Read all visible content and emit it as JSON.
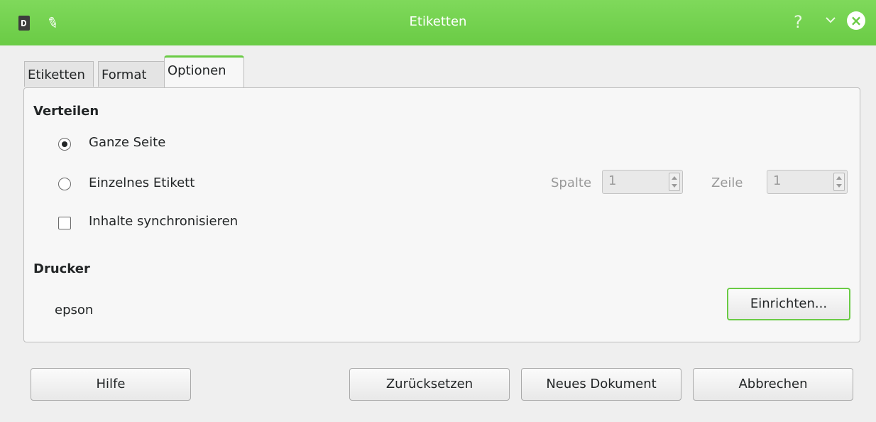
{
  "window": {
    "title": "Etiketten"
  },
  "tabs": [
    {
      "label": "Etiketten"
    },
    {
      "label": "Format"
    },
    {
      "label": "Optionen"
    }
  ],
  "distribution": {
    "heading": "Verteilen",
    "whole_page": "Ganze Seite",
    "single_label": "Einzelnes Etikett",
    "sync_contents": "Inhalte synchronisieren",
    "column_label": "Spalte",
    "column_value": "1",
    "row_label": "Zeile",
    "row_value": "1"
  },
  "printer": {
    "heading": "Drucker",
    "name": "epson",
    "setup_button": "Einrichten..."
  },
  "footer": {
    "help": "Hilfe",
    "reset": "Zurücksetzen",
    "new_document": "Neues Dokument",
    "cancel": "Abbrechen"
  },
  "colors": {
    "accent": "#6acb45"
  },
  "icons": [
    "app-icon",
    "pin-icon",
    "help-icon",
    "chevron-down-icon",
    "close-icon"
  ]
}
